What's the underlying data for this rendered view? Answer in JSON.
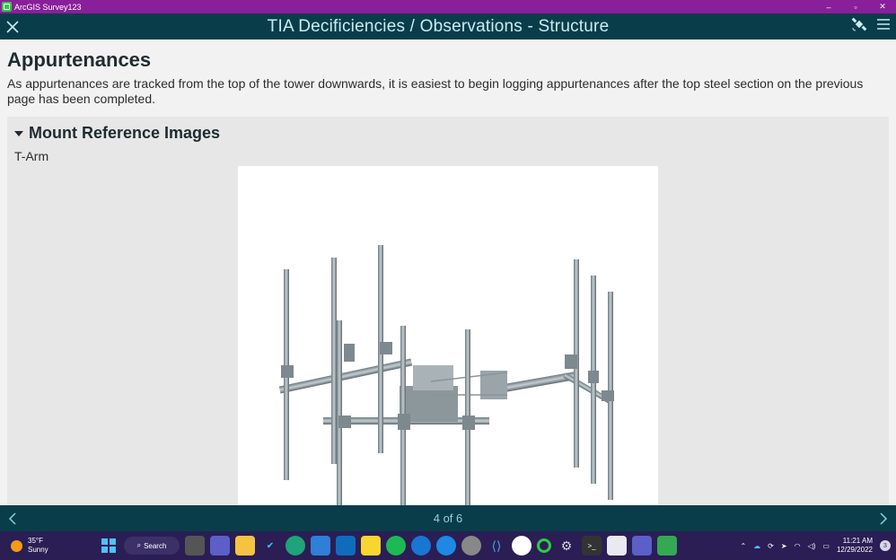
{
  "window": {
    "title": "ArcGIS Survey123",
    "minimize": "–",
    "restore": "▫",
    "close": "✕"
  },
  "header": {
    "title": "TIA Decificiencies / Observations - Structure"
  },
  "page": {
    "title": "Appurtenances",
    "intro": "As appurtenances are tracked from the top of the tower downwards, it is easiest to begin logging appurtenances after the top steel section on the previous page has been completed."
  },
  "group": {
    "label": "Mount Reference Images",
    "image_label": "T-Arm"
  },
  "footer": {
    "pager": "4 of 6"
  },
  "taskbar": {
    "weather_temp": "35°F",
    "weather_desc": "Sunny",
    "search_label": "Search",
    "time": "11:21 AM",
    "date": "12/29/2022",
    "notification_count": "3"
  },
  "colors": {
    "titlebar": "#8a1f9a",
    "header": "#0a3d4a",
    "header_text": "#c9ecf3",
    "taskbar": "#2a1e55"
  }
}
